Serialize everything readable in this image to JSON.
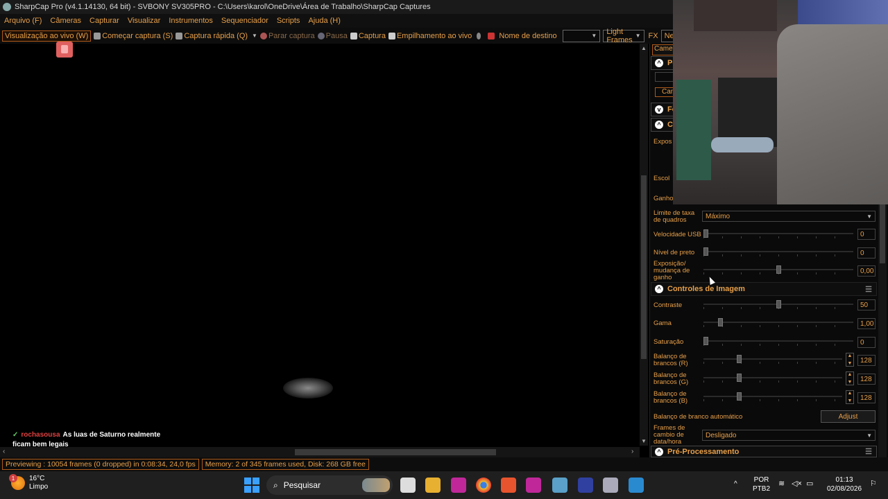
{
  "title": "SharpCap Pro (v4.1.14130, 64 bit) - SVBONY SV305PRO - C:\\Users\\karol\\OneDrive\\Área de Trabalho\\SharpCap Captures",
  "menu": [
    "Arquivo (F)",
    "Câmeras",
    "Capturar",
    "Visualizar",
    "Instrumentos",
    "Sequenciador",
    "Scripts",
    "Ajuda (H)"
  ],
  "toolbar": {
    "live_view": "Visualização ao vivo (W)",
    "start_capture": "Começar captura (S)",
    "quick_capture": "Captura rápida (Q)",
    "stop_capture": "Parar captura",
    "pause": "Pausa",
    "snapshot": "Captura",
    "live_stack": "Empilhamento ao vivo",
    "target_name": "Nome de destino",
    "target_value": "",
    "frame_type": "Light Frames",
    "fx": "FX",
    "fx_value": "Nenh"
  },
  "chat": {
    "user": "rochasousa",
    "message": "As luas de Saturno realmente ficam bem legais"
  },
  "status": {
    "previewing": "Previewing : 10054 frames (0 dropped) in 0:08:34, 24,0 fps",
    "memory": "Memory: 2 of 345 frames used, Disk: 268 GB free"
  },
  "panel": {
    "tab": "Camera",
    "section1": "Pe",
    "cam_btn": "Can",
    "section2": "Fo",
    "section3": "Co",
    "expo_label": "Expos",
    "escol_label": "Escol",
    "ganho_label": "Ganho",
    "frame_limit_label": "Limite de taxa de quadros",
    "frame_limit_value": "Máximo",
    "usb_label": "Velocidade USB",
    "usb_value": "0",
    "usb_level": 0,
    "black_label": "Nível de preto",
    "black_value": "0",
    "black_level": 0,
    "expo_gain_label": "Exposição/ mudança de ganho",
    "expo_gain_value": "0,00",
    "expo_gain_level": 0.5,
    "image_controls": "Controles de Imagem",
    "contrast_label": "Contraste",
    "contrast_value": "50",
    "contrast_level": 0.5,
    "gamma_label": "Gama",
    "gamma_value": "1,00",
    "gamma_level": 0.1,
    "saturation_label": "Saturação",
    "saturation_value": "0",
    "saturation_level": 0,
    "wb_r_label": "Balanço de brancos (R)",
    "wb_r_value": "128",
    "wb_r_level": 0.25,
    "wb_g_label": "Balanço de brancos (G)",
    "wb_g_value": "128",
    "wb_g_level": 0.25,
    "wb_b_label": "Balanço de brancos (B)",
    "wb_b_value": "128",
    "wb_b_level": 0.25,
    "auto_wb_label": "Balanço de branco automático",
    "adjust_label": "Adjust",
    "frames_change_label": "Frames de cambio de data/hora",
    "frames_change_value": "Desligado",
    "preprocess": "Pré-Processamento"
  },
  "taskbar": {
    "temp": "16°C",
    "weather": "Limpo",
    "weather_badge": "1",
    "search_placeholder": "Pesquisar",
    "lang": "POR",
    "layout": "PTB2",
    "time": "01:13",
    "date": "02/08/2026"
  },
  "colors": {
    "accent": "#e8a04a",
    "border_accent": "#b05a1a",
    "background": "#000000"
  }
}
